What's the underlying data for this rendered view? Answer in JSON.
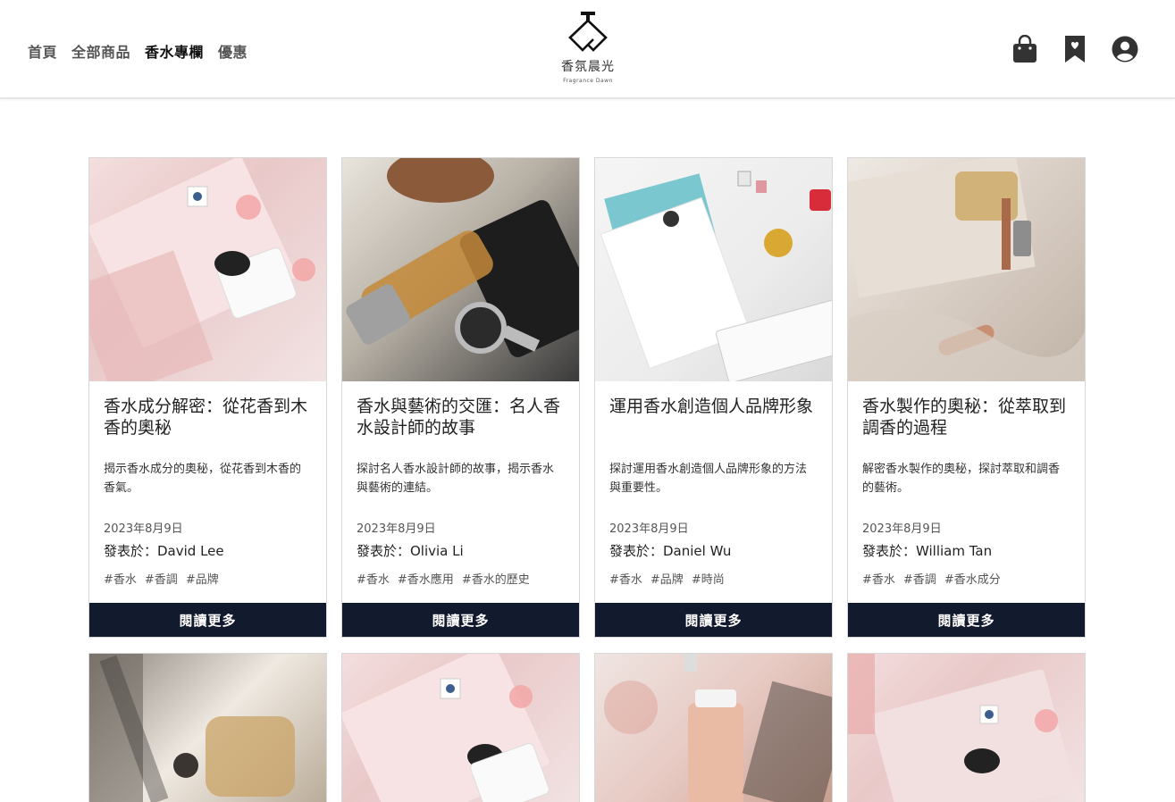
{
  "nav": {
    "items": [
      {
        "label": "首頁",
        "active": false
      },
      {
        "label": "全部商品",
        "active": false
      },
      {
        "label": "香水專欄",
        "active": true
      },
      {
        "label": "優惠",
        "active": false
      }
    ]
  },
  "brand": {
    "name_cn": "香氛晨光",
    "name_en": "Fragrance Dawn"
  },
  "header_icons": [
    "shopping-bag-icon",
    "bookmark-heart-icon",
    "user-account-icon"
  ],
  "colors": {
    "button_bg": "#121a2e",
    "button_text": "#ffffff",
    "nav_active": "#111111"
  },
  "articles": [
    {
      "title": "香水成分解密：從花香到木香的奧秘",
      "description": "揭示香水成分的奧秘，從花香到木香的香氣。",
      "date": "2023年8月9日",
      "author": "發表於：David Lee",
      "tags": [
        "#香水",
        "#香調",
        "#品牌"
      ],
      "button": "閱讀更多"
    },
    {
      "title": "香水與藝術的交匯：名人香水設計師的故事",
      "description": "探討名人香水設計師的故事，揭示香水與藝術的連結。",
      "date": "2023年8月9日",
      "author": "發表於：Olivia Li",
      "tags": [
        "#香水",
        "#香水應用",
        "#香水的歷史"
      ],
      "button": "閱讀更多"
    },
    {
      "title": "運用香水創造個人品牌形象",
      "description": "探討運用香水創造個人品牌形象的方法與重要性。",
      "date": "2023年8月9日",
      "author": "發表於：Daniel Wu",
      "tags": [
        "#香水",
        "#品牌",
        "#時尚"
      ],
      "button": "閱讀更多"
    },
    {
      "title": "香水製作的奧秘：從萃取到調香的過程",
      "description": "解密香水製作的奧秘，探討萃取和調香的藝術。",
      "date": "2023年8月9日",
      "author": "發表於：William Tan",
      "tags": [
        "#香水",
        "#香調",
        "#香水成分"
      ],
      "button": "閱讀更多"
    }
  ]
}
